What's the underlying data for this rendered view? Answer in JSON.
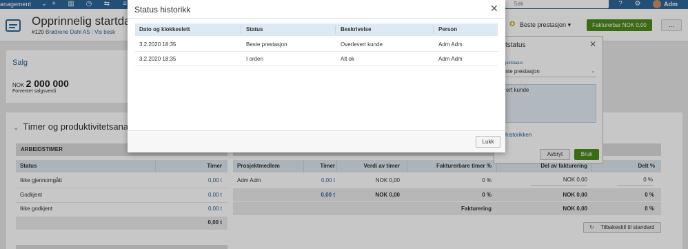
{
  "topnav": {
    "title": "anagement",
    "icons": [
      "chevron-down-icon",
      "plus-icon",
      "chart-icon",
      "history-icon",
      "transfer-icon",
      "list-icon",
      "table-icon",
      "bolt-icon"
    ],
    "search_placeholder": "Søk",
    "user_name": "Adm"
  },
  "header": {
    "title": "Opprinnelig startdato",
    "project_number": "#120",
    "customer": "Brødrene Dahl AS",
    "view_label": "Vis besk",
    "status_label": "Beste prestasjon",
    "billable_button": "Fakturerbar NOK 0,00",
    "more_button": "..."
  },
  "sales_card": {
    "title": "Salg",
    "currency": "NOK",
    "amount": "2 000 000",
    "caption": "Forventet salgsverdi"
  },
  "section": {
    "title": "Timer og produktivitetsana"
  },
  "work_hours": {
    "title": "ARBEIDSTIMER",
    "col_status": "Status",
    "col_hours": "Timer",
    "rows": [
      {
        "status": "Ikke gjennomgått",
        "hours": "0,00 t"
      },
      {
        "status": "Godkjent",
        "hours": "0,00 t"
      },
      {
        "status": "Ikke godkjent",
        "hours": "0,00 t"
      }
    ],
    "total": "0,00 t"
  },
  "members": {
    "headers": [
      "Prosjektmedlem",
      "Timer",
      "Verdi av timer",
      "Fakturerbare timer %",
      "Del av fakturering",
      "Delt %"
    ],
    "row": {
      "member": "Adm Adm",
      "hours": "0,00 t",
      "value": "NOK 0,00",
      "billable_pct": "0 %",
      "share": "NOK 0,00",
      "split": "0 %"
    },
    "total": {
      "hours": "0,00 t",
      "value": "NOK 0,00",
      "billable_pct": "0 %",
      "share": "NOK 0,00",
      "split": "0 %"
    },
    "invoice_row": {
      "label": "Fakturering",
      "share": "NOK 0,00",
      "split": "0 %"
    },
    "reset_button": "Tilbakestill til standard"
  },
  "status_panel": {
    "title": "tstatus",
    "field_label": "jektstatus",
    "selected": "ste prestasjon",
    "comment": "ert kunde",
    "history_link": "historikken",
    "cancel": "Avbryt",
    "save": "Bruk"
  },
  "modal": {
    "title": "Status historikk",
    "columns": [
      "Dato og klokkeslett",
      "Status",
      "Beskrivelse",
      "Person"
    ],
    "rows": [
      {
        "date": "3.2.2020   18:35",
        "status": "Beste prestasjon",
        "desc": "Overlevert kunde",
        "person": "Adm Adm"
      },
      {
        "date": "3.2.2020   18:35",
        "status": "I orden",
        "desc": "Alt ok",
        "person": "Adm Adm"
      }
    ],
    "close_button": "Lukk"
  }
}
